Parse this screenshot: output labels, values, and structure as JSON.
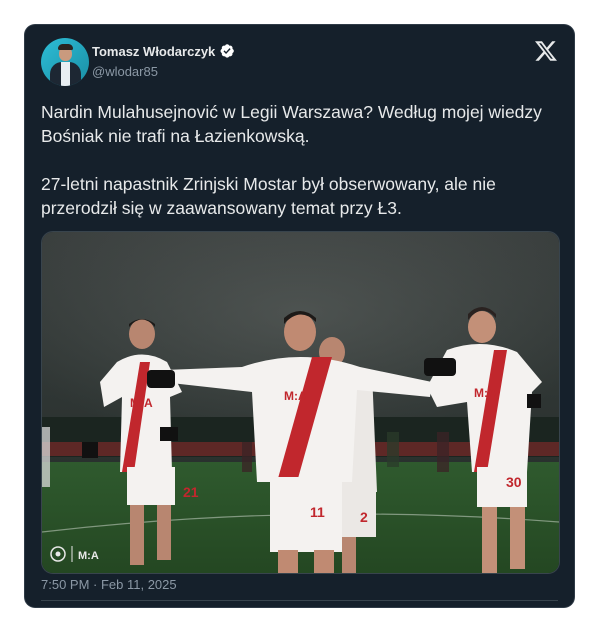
{
  "author": {
    "display_name": "Tomasz Włodarczyk",
    "handle": "@wlodar85",
    "verified": true,
    "avatar_icon": "avatar-photo",
    "avatar_color": "#2dbdd6"
  },
  "platform": {
    "logo_icon": "x-logo-icon"
  },
  "tweet": {
    "paragraph_1": "Nardin Mulahusejnović w Legii Warszawa? Według mojej wiedzy Bośniak nie trafi na Łazienkowską.",
    "paragraph_2": "27-letni napastnik Zrinjski Mostar był obserwowany, ale nie przerodził się w zaawansowany temat przy Ł3."
  },
  "media": {
    "type": "photo",
    "players": [
      {
        "shirt_number": "21",
        "sponsor": "M:A"
      },
      {
        "shirt_number": "11",
        "sponsor": "M:A"
      },
      {
        "shirt_number": "2",
        "sponsor": "M:A"
      },
      {
        "shirt_number": "30",
        "sponsor": "M:A"
      }
    ],
    "watermark": "M:A",
    "kit_colors": {
      "shirt": "#f4f2f0",
      "stripe": "#c1272d",
      "pitch": "#2f5a2e"
    }
  },
  "meta": {
    "timestamp": "7:50 PM · Feb 11, 2025"
  },
  "colors": {
    "card_bg": "#15202b",
    "text_primary": "#e7e9ea",
    "text_secondary": "#8b98a5",
    "border": "#38444d"
  }
}
